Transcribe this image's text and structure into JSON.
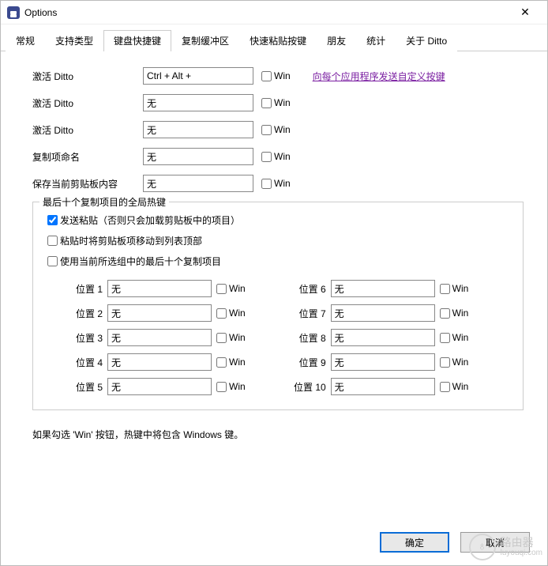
{
  "window": {
    "title": "Options"
  },
  "tabs": [
    "常规",
    "支持类型",
    "键盘快捷键",
    "复制缓冲区",
    "快速粘贴按键",
    "朋友",
    "统计",
    "关于 Ditto"
  ],
  "active_tab_index": 2,
  "link_text": "向每个应用程序发送自定义按键",
  "win_label": "Win",
  "hotkeys": [
    {
      "label": "激活 Ditto",
      "value": "Ctrl + Alt + "
    },
    {
      "label": "激活 Ditto",
      "value": "无"
    },
    {
      "label": "激活 Ditto",
      "value": "无"
    },
    {
      "label": "复制项命名",
      "value": "无"
    },
    {
      "label": "保存当前剪贴板内容",
      "value": "无"
    }
  ],
  "group": {
    "legend": "最后十个复制项目的全局热键",
    "checks": [
      {
        "label": "发送粘贴（否则只会加载剪贴板中的项目）",
        "checked": true
      },
      {
        "label": "粘贴时将剪贴板项移动到列表顶部",
        "checked": false
      },
      {
        "label": "使用当前所选组中的最后十个复制项目",
        "checked": false
      }
    ],
    "pos_label_prefix": "位置",
    "positions_left": [
      {
        "n": "1",
        "v": "无"
      },
      {
        "n": "2",
        "v": "无"
      },
      {
        "n": "3",
        "v": "无"
      },
      {
        "n": "4",
        "v": "无"
      },
      {
        "n": "5",
        "v": "无"
      }
    ],
    "positions_right": [
      {
        "n": "6",
        "v": "无"
      },
      {
        "n": "7",
        "v": "无"
      },
      {
        "n": "8",
        "v": "无"
      },
      {
        "n": "9",
        "v": "无"
      },
      {
        "n": "10",
        "v": "无"
      }
    ]
  },
  "note": "如果勾选 'Win' 按钮，热键中将包含 Windows 键。",
  "buttons": {
    "ok": "确定",
    "cancel": "取消"
  },
  "watermark": {
    "big": "路由器",
    "small": "luyouqi.com"
  }
}
